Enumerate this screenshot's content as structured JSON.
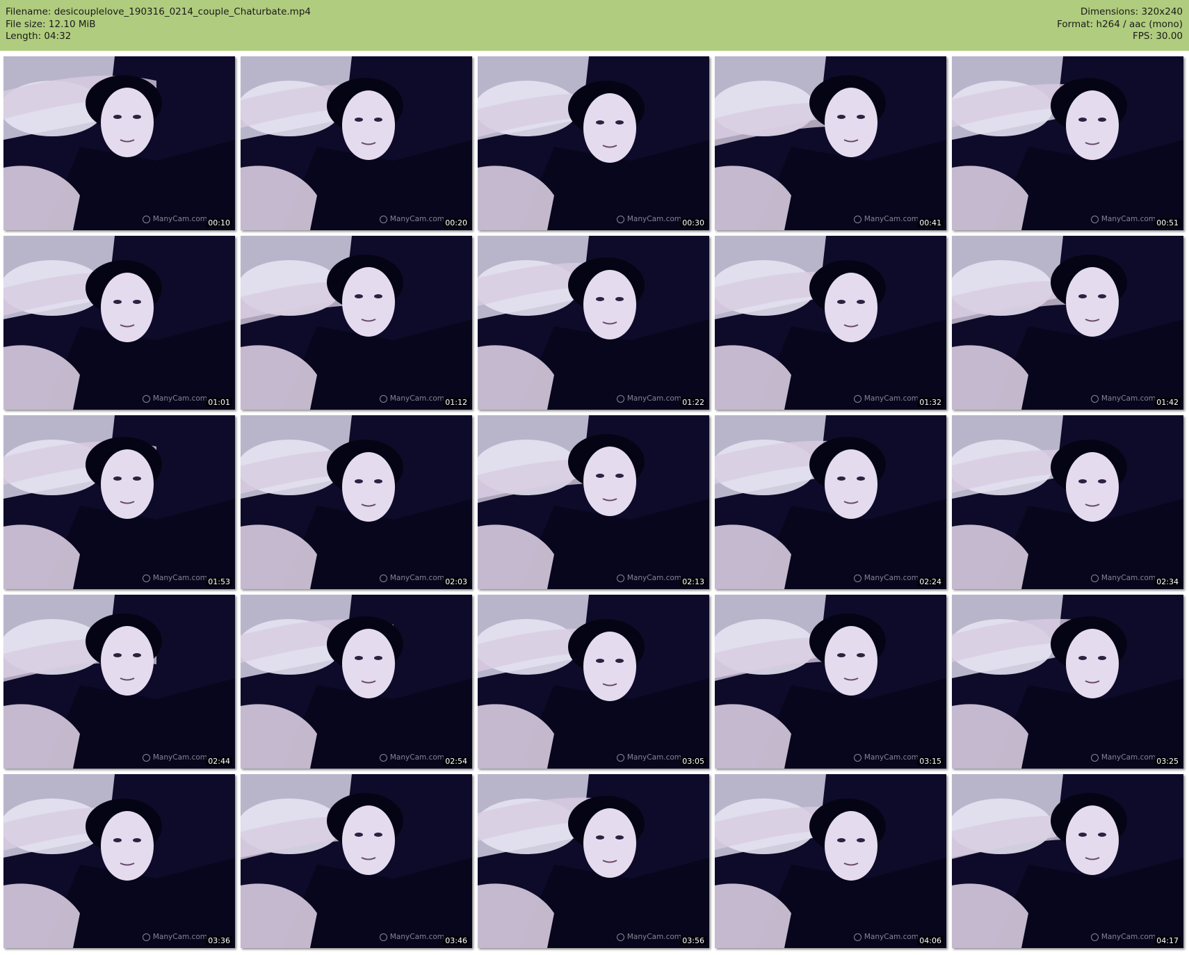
{
  "header": {
    "filename": "Filename: desicouplelove_190316_0214_couple_Chaturbate.mp4",
    "filesize": "File size: 12.10 MiB",
    "length": "Length: 04:32",
    "dimensions": "Dimensions: 320x240",
    "format": "Format: h264 / aac (mono)",
    "fps": "FPS: 30.00"
  },
  "thumbnail_watermark": "ManyCam.com",
  "thumbnails": [
    {
      "timestamp": "00:10"
    },
    {
      "timestamp": "00:20"
    },
    {
      "timestamp": "00:30"
    },
    {
      "timestamp": "00:41"
    },
    {
      "timestamp": "00:51"
    },
    {
      "timestamp": "01:01"
    },
    {
      "timestamp": "01:12"
    },
    {
      "timestamp": "01:22"
    },
    {
      "timestamp": "01:32"
    },
    {
      "timestamp": "01:42"
    },
    {
      "timestamp": "01:53"
    },
    {
      "timestamp": "02:03"
    },
    {
      "timestamp": "02:13"
    },
    {
      "timestamp": "02:24"
    },
    {
      "timestamp": "02:34"
    },
    {
      "timestamp": "02:44"
    },
    {
      "timestamp": "02:54"
    },
    {
      "timestamp": "03:05"
    },
    {
      "timestamp": "03:15"
    },
    {
      "timestamp": "03:25"
    },
    {
      "timestamp": "03:36"
    },
    {
      "timestamp": "03:46"
    },
    {
      "timestamp": "03:56"
    },
    {
      "timestamp": "04:06"
    },
    {
      "timestamp": "04:17"
    }
  ],
  "colors": {
    "header_bg": "#b0cc7e",
    "frame_dark": "#0e0b2a",
    "frame_light": "#e6e2f2",
    "frame_skin": "#d8cce0"
  }
}
